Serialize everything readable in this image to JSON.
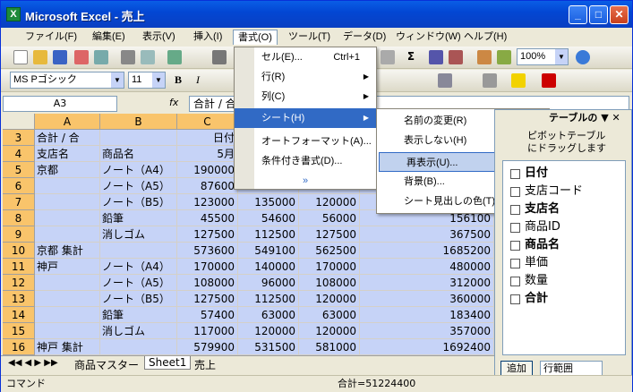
{
  "window": {
    "title": "Microsoft Excel - 売上",
    "app_icon": "excel-icon"
  },
  "menubar": [
    "ファイル(F)",
    "編集(E)",
    "表示(V)",
    "挿入(I)",
    "書式(O)",
    "ツール(T)",
    "データ(D)",
    "ウィンドウ(W)",
    "ヘルプ(H)"
  ],
  "toolbar": {
    "zoom": "100%",
    "font": "MS Pゴシック",
    "size": "11",
    "bold": "B",
    "italic": "I",
    "sigma": "Σ"
  },
  "formula": {
    "namebox": "A3",
    "fx": "fx",
    "content": "合計 / 合"
  },
  "columns": [
    "A",
    "B",
    "C"
  ],
  "rows": [
    {
      "n": "3",
      "a": "合計 / 合",
      "b": "",
      "c": "日付"
    },
    {
      "n": "4",
      "a": "支店名",
      "b": "商品名",
      "c": "5月"
    },
    {
      "n": "5",
      "a": "京都",
      "b": "ノート（A4）",
      "c": "190000",
      "d": "",
      "e": "",
      "f": ""
    },
    {
      "n": "6",
      "a": "",
      "b": "ノート（A5）",
      "c": "87600",
      "d": "",
      "e": "",
      "f": ""
    },
    {
      "n": "7",
      "a": "",
      "b": "ノート（B5）",
      "c": "123000",
      "d": "135000",
      "e": "120000",
      "f": "378000"
    },
    {
      "n": "8",
      "a": "",
      "b": "鉛筆",
      "c": "45500",
      "d": "54600",
      "e": "56000",
      "f": "156100"
    },
    {
      "n": "9",
      "a": "",
      "b": "消しゴム",
      "c": "127500",
      "d": "112500",
      "e": "127500",
      "f": "367500"
    },
    {
      "n": "10",
      "a": "京都 集計",
      "b": "",
      "c": "573600",
      "d": "549100",
      "e": "562500",
      "f": "1685200"
    },
    {
      "n": "11",
      "a": "神戸",
      "b": "ノート（A4）",
      "c": "170000",
      "d": "140000",
      "e": "170000",
      "f": "480000"
    },
    {
      "n": "12",
      "a": "",
      "b": "ノート（A5）",
      "c": "108000",
      "d": "96000",
      "e": "108000",
      "f": "312000"
    },
    {
      "n": "13",
      "a": "",
      "b": "ノート（B5）",
      "c": "127500",
      "d": "112500",
      "e": "120000",
      "f": "360000"
    },
    {
      "n": "14",
      "a": "",
      "b": "鉛筆",
      "c": "57400",
      "d": "63000",
      "e": "63000",
      "f": "183400"
    },
    {
      "n": "15",
      "a": "",
      "b": "消しゴム",
      "c": "117000",
      "d": "120000",
      "e": "120000",
      "f": "357000"
    },
    {
      "n": "16",
      "a": "神戸 集計",
      "b": "",
      "c": "579900",
      "d": "531500",
      "e": "581000",
      "f": "1692400"
    }
  ],
  "format_menu": [
    "セル(E)...",
    "行(R)",
    "列(C)",
    "シート(H)",
    "オートフォーマット(A)...",
    "条件付き書式(D)..."
  ],
  "format_menu_shortcut": "Ctrl+1",
  "sheet_menu": [
    "名前の変更(R)",
    "表示しない(H)",
    "再表示(U)...",
    "背景(B)...",
    "シート見出しの色(T)..."
  ],
  "panel": {
    "title": "テーブルの",
    "hint1": "ピボットテーブル",
    "hint2": "にドラッグします",
    "fields": [
      "日付",
      "支店コード",
      "支店名",
      "商品ID",
      "商品名",
      "単価",
      "数量",
      "合計"
    ],
    "add": "追加",
    "target": "行範囲"
  },
  "sheets": [
    "商品マスター",
    "Sheet1",
    "売上"
  ],
  "status": {
    "mode": "コマンド",
    "sum": "合計=51224400"
  }
}
